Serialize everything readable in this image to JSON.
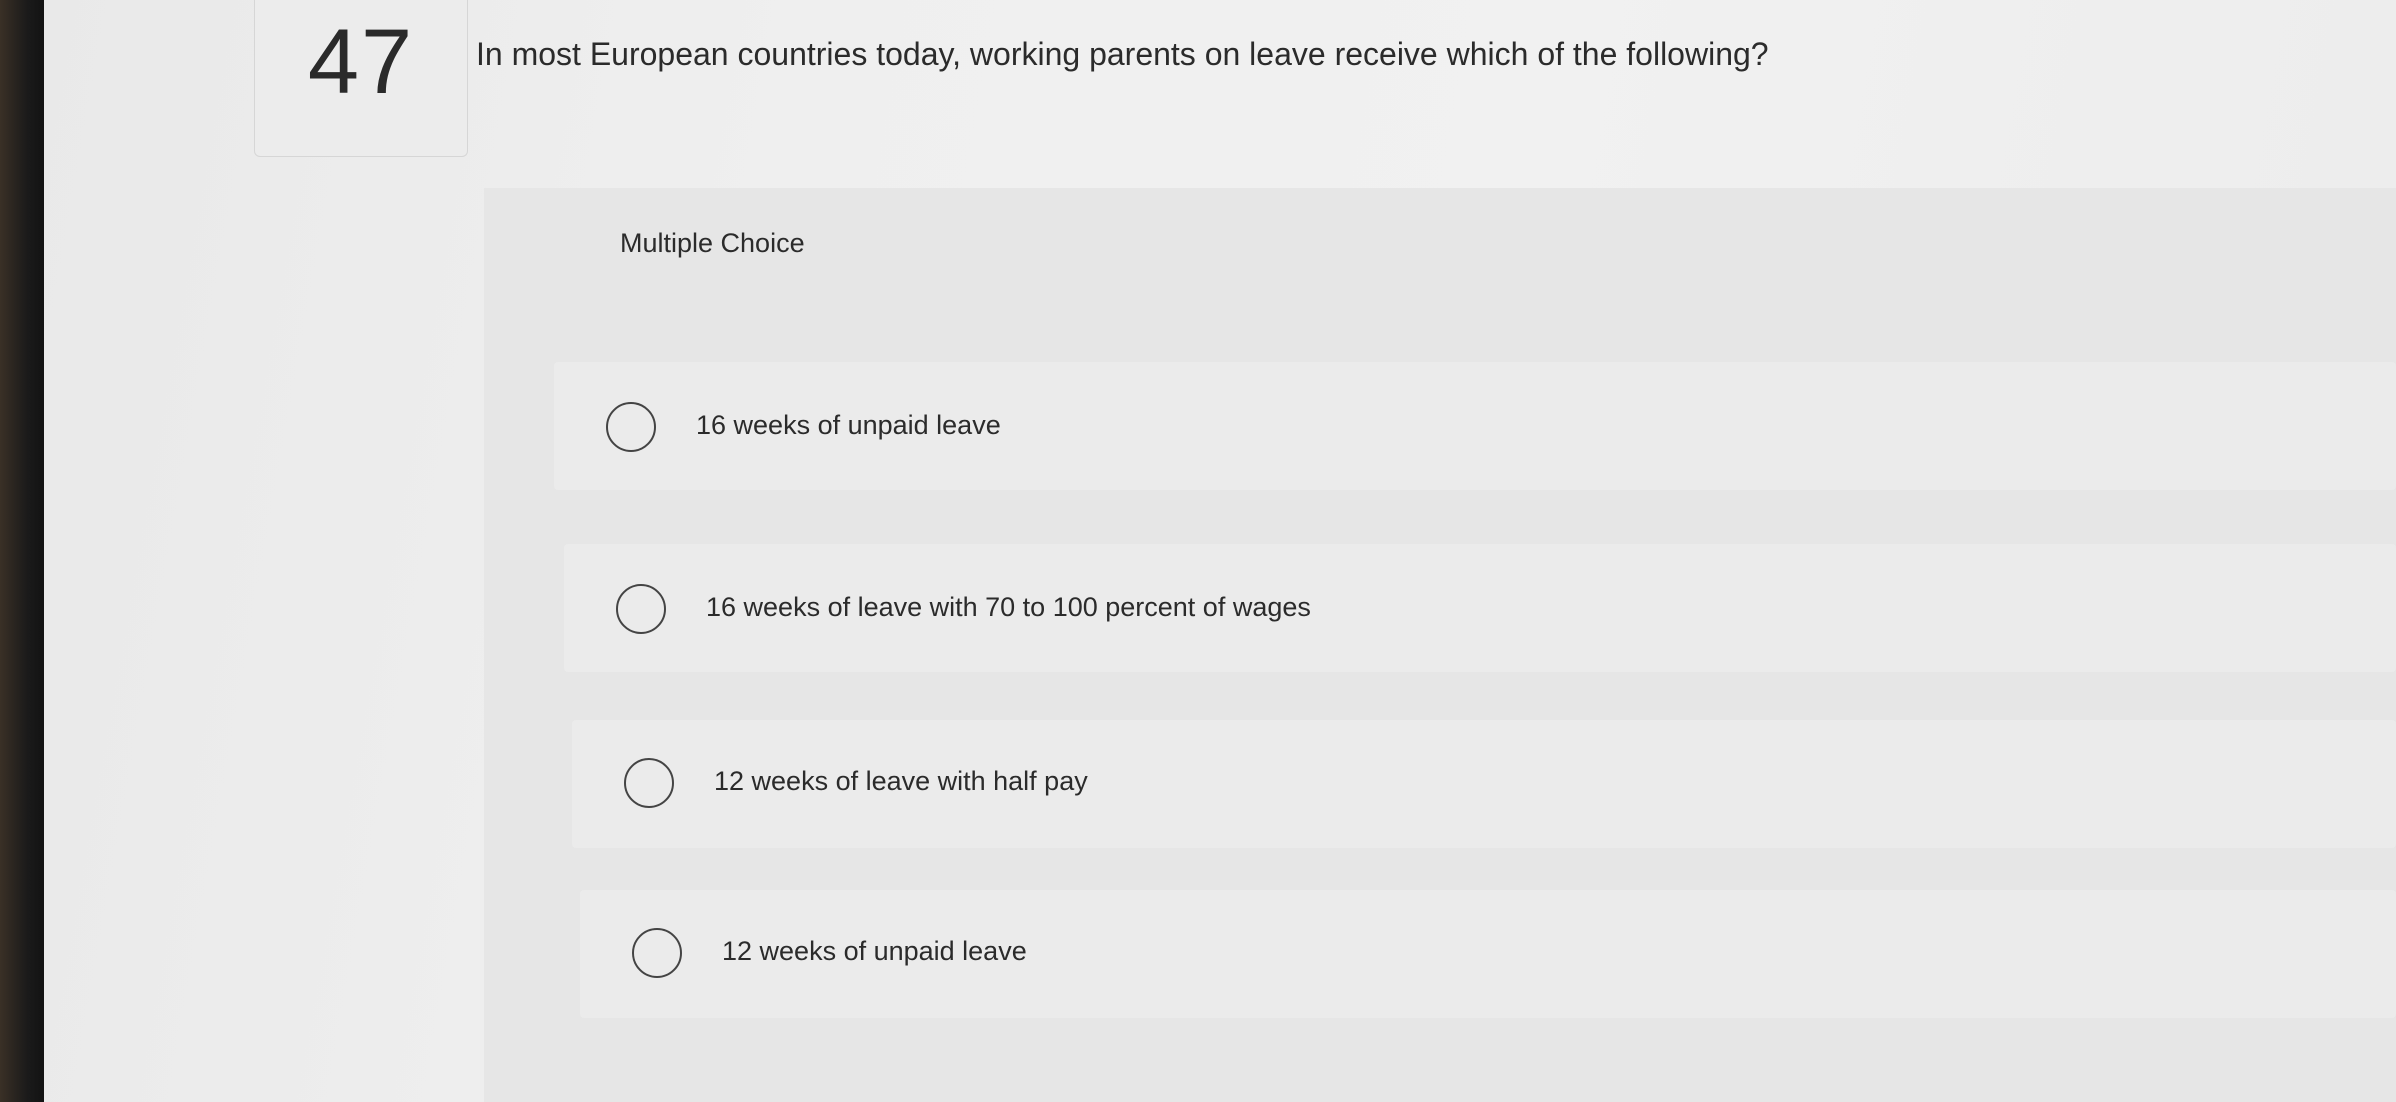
{
  "question": {
    "number": "47",
    "text": "In most European countries today, working parents on leave receive which of the following?"
  },
  "quiz": {
    "type_label": "Multiple Choice",
    "options": [
      {
        "label": "16 weeks of unpaid leave",
        "selected": false
      },
      {
        "label": "16 weeks of leave with 70 to 100 percent of wages",
        "selected": false
      },
      {
        "label": "12 weeks of leave with half pay",
        "selected": false
      },
      {
        "label": "12 weeks of unpaid leave",
        "selected": false
      }
    ]
  }
}
